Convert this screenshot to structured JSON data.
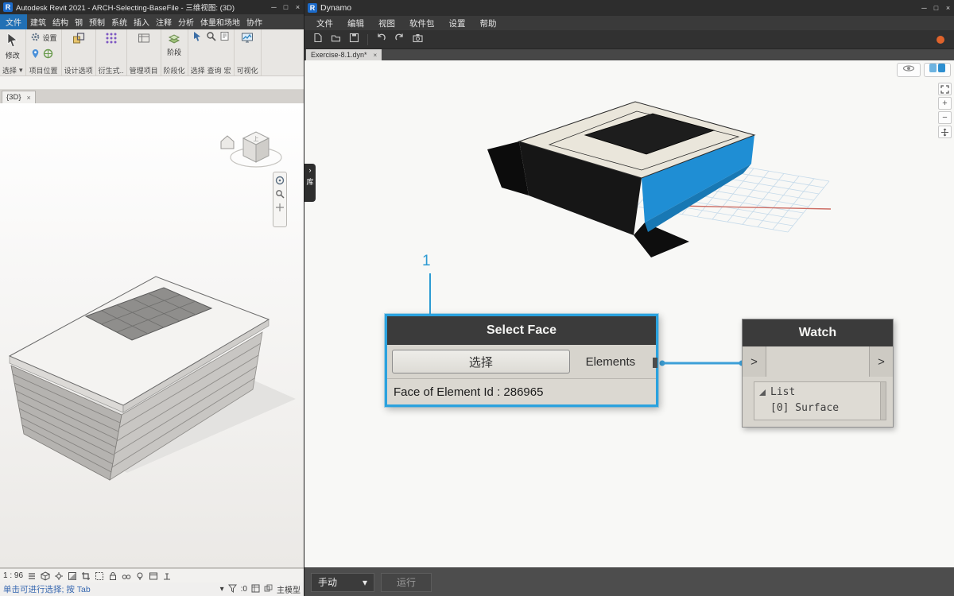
{
  "revit": {
    "logo": "R",
    "title": "Autodesk Revit 2021 - ARCH-Selecting-BaseFile - 三维视图: (3D)",
    "window": {
      "minimize": "─",
      "maximize": "□",
      "close": "×"
    },
    "icons": {
      "caret_down": "▾"
    },
    "menu_tabs": [
      "文件",
      "建筑",
      "结构",
      "钢",
      "预制",
      "系统",
      "插入",
      "注释",
      "分析",
      "体量和场地",
      "协作"
    ],
    "ribbon": {
      "modify": "修改",
      "select_panel": "选择",
      "settings": "设置",
      "project_location": "项目位置",
      "design_options": "设计选项",
      "generative": "衍生式..",
      "manage_project": "管理项目",
      "phase": "阶段",
      "phasing_panel": "阶段化",
      "select": "选择",
      "query": "查询",
      "macro": "宏",
      "visualize": "可视化"
    },
    "view_tab": {
      "label": "{3D}",
      "close": "×"
    },
    "viewcube": {
      "top": "上"
    },
    "view_bar": {
      "scale": "1 : 96"
    },
    "status_bar": {
      "message": "单击可进行选择; 按 Tab",
      "counter": ":0",
      "active_model": "主模型"
    }
  },
  "dynamo": {
    "logo": "R",
    "title": "Dynamo",
    "window": {
      "minimize": "─",
      "maximize": "□",
      "close": "×"
    },
    "menu": [
      "文件",
      "编辑",
      "视图",
      "软件包",
      "设置",
      "帮助"
    ],
    "tab": {
      "label": "Exercise-8.1.dyn*",
      "close": "×"
    },
    "library": {
      "arrow": "›",
      "label": "库"
    },
    "canvas_controls": {
      "zoom_in": "+",
      "zoom_out": "−"
    },
    "annotation": "1",
    "select_face_node": {
      "title": "Select Face",
      "button": "选择",
      "output": "Elements",
      "status": "Face of Element Id : 286965"
    },
    "watch_node": {
      "title": "Watch",
      "input_port": ">",
      "output_port": ">",
      "list_label": "List",
      "list_item": "[0] Surface"
    },
    "run_bar": {
      "mode": "手动",
      "caret": "▾",
      "run": "运行"
    },
    "colors": {
      "selection": "#2BA2DE",
      "wire": "#3DA0D8",
      "highlight_face": "#1F8ED4"
    }
  }
}
